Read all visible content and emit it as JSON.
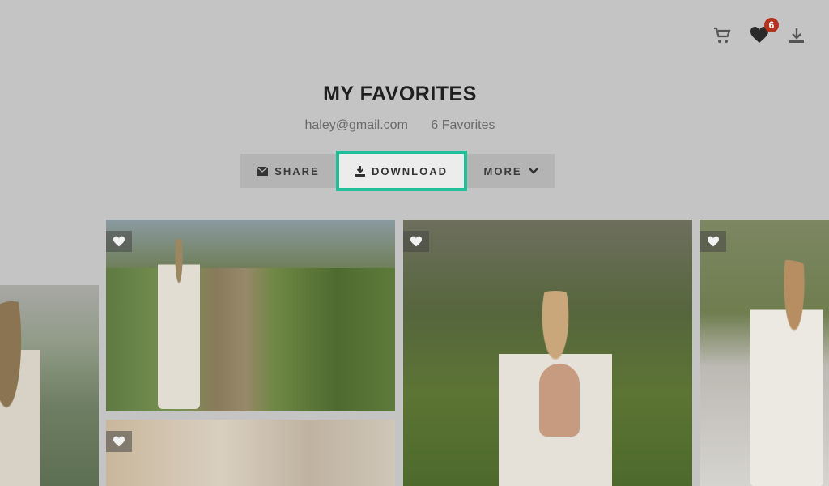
{
  "header": {
    "icons": [
      "cart-icon",
      "heart-icon",
      "download-icon"
    ],
    "favorites_badge": "6"
  },
  "page": {
    "title": "MY FAVORITES",
    "email": "haley@gmail.com",
    "favorites_count": "6 Favorites"
  },
  "toolbar": {
    "share_label": "SHARE",
    "download_label": "DOWNLOAD",
    "more_label": "MORE"
  },
  "colors": {
    "accent_highlight": "#1ebf99",
    "badge": "#b5321e",
    "overlay": "#c4c4c4"
  },
  "gallery": {
    "photos": [
      {
        "name": "photo-left-partial"
      },
      {
        "name": "photo-vineyard-path"
      },
      {
        "name": "photo-lace-back"
      },
      {
        "name": "photo-car"
      },
      {
        "name": "photo-detail"
      }
    ]
  }
}
